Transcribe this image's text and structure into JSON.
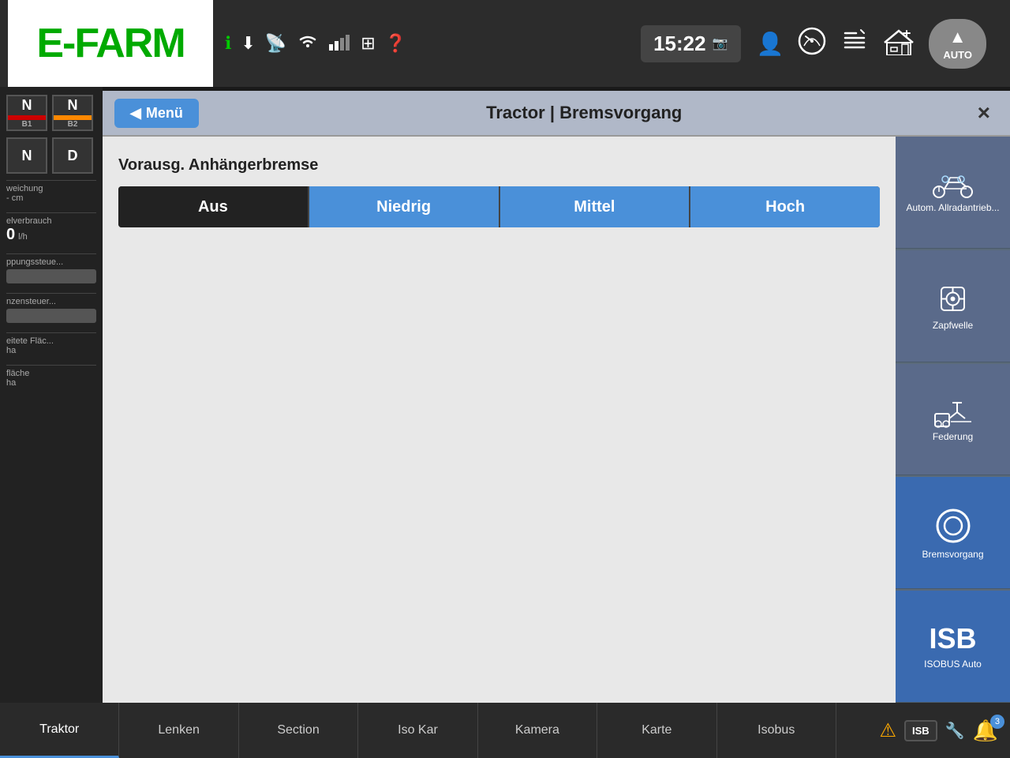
{
  "logo": {
    "text": "E-FARM"
  },
  "topbar": {
    "clock": "15:22",
    "auto_label": "AUTO"
  },
  "sidebar": {
    "gear1": {
      "value": "N",
      "label": "B1"
    },
    "gear2": {
      "value": "N",
      "label": "B2"
    },
    "gear3": {
      "value": "N",
      "label": ""
    },
    "gear4": {
      "value": "D",
      "label": ""
    },
    "items": [
      {
        "label": "weichung",
        "sub": "- cm"
      },
      {
        "label": "elverbrauch",
        "value": "0",
        "unit": "l/h"
      },
      {
        "label": "ppungssteue..."
      },
      {
        "label": "nzensteuer..."
      },
      {
        "label": "eitete Fläc...",
        "sub": "ha"
      },
      {
        "label": "fläche",
        "sub": "ha"
      }
    ]
  },
  "dialog": {
    "menu_label": "Menü",
    "title": "Tractor | Bremsvorgang",
    "close_label": "×",
    "section_title": "Vorausg. Anhängerbremse",
    "brake_options": [
      {
        "label": "Aus",
        "selected": true
      },
      {
        "label": "Niedrig",
        "active": true
      },
      {
        "label": "Mittel",
        "active": true
      },
      {
        "label": "Hoch",
        "active": true
      }
    ],
    "right_sidebar": [
      {
        "label": "Autom. Allradantrieb...",
        "icon": "tractor"
      },
      {
        "label": "Zapfwelle",
        "icon": "gear"
      },
      {
        "label": "Federung",
        "icon": "suspension"
      },
      {
        "label": "Bremsvorgang",
        "icon": "brake",
        "active": true
      },
      {
        "label": "ISOBUS Auto",
        "icon": "isb"
      }
    ]
  },
  "bottombar": {
    "tabs": [
      {
        "label": "Traktor",
        "active": true
      },
      {
        "label": "Lenken"
      },
      {
        "label": "Section"
      },
      {
        "label": "Iso Kar"
      },
      {
        "label": "Kamera"
      },
      {
        "label": "Karte"
      },
      {
        "label": "Isobus"
      }
    ],
    "notification_count": "3"
  }
}
